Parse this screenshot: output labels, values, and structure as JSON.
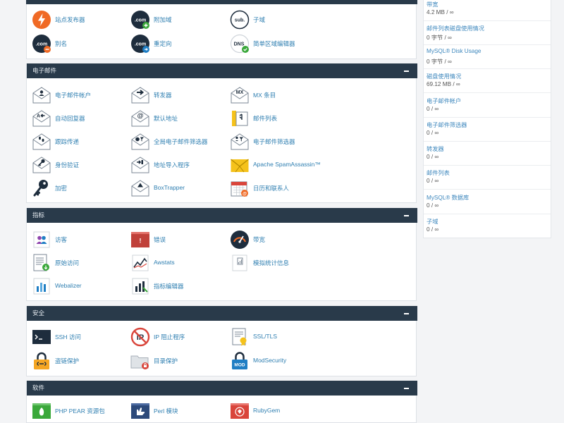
{
  "top_section": {
    "items": [
      {
        "label": "站点发布器",
        "icon": "bolt-icon"
      },
      {
        "label": "附加域",
        "icon": "dotcom-plus-icon"
      },
      {
        "label": "子域",
        "icon": "sub-icon"
      },
      {
        "label": "别名",
        "icon": "dotcom-minus-icon"
      },
      {
        "label": "重定向",
        "icon": "dotcom-redirect-icon"
      },
      {
        "label": "简单区域编辑器",
        "icon": "dns-icon"
      }
    ]
  },
  "email_section": {
    "title": "电子邮件",
    "items": [
      {
        "label": "电子邮件帐户",
        "icon": "email-accounts-icon"
      },
      {
        "label": "转发器",
        "icon": "forwarders-icon"
      },
      {
        "label": "MX 条目",
        "icon": "mx-entry-icon",
        "badge": "MX"
      },
      {
        "label": "自动回复器",
        "icon": "autoresponder-icon"
      },
      {
        "label": "默认地址",
        "icon": "default-address-icon"
      },
      {
        "label": "邮件列表",
        "icon": "mailing-lists-icon"
      },
      {
        "label": "跟踪传递",
        "icon": "track-delivery-icon"
      },
      {
        "label": "全局电子邮件筛选器",
        "icon": "global-filters-icon"
      },
      {
        "label": "电子邮件筛选器",
        "icon": "email-filters-icon"
      },
      {
        "label": "身份验证",
        "icon": "authentication-icon"
      },
      {
        "label": "地址导入程序",
        "icon": "address-importer-icon"
      },
      {
        "label": "Apache SpamAssassin™",
        "icon": "spamassassin-icon"
      },
      {
        "label": "加密",
        "icon": "key-icon"
      },
      {
        "label": "BoxTrapper",
        "icon": "boxtrapper-icon"
      },
      {
        "label": "日历和联系人",
        "icon": "calendar-icon"
      }
    ]
  },
  "metrics_section": {
    "title": "指标",
    "items": [
      {
        "label": "访客",
        "icon": "visitors-icon"
      },
      {
        "label": "错误",
        "icon": "errors-icon"
      },
      {
        "label": "带宽",
        "icon": "bandwidth-icon"
      },
      {
        "label": "原始访问",
        "icon": "raw-access-icon"
      },
      {
        "label": "Awstats",
        "icon": "awstats-icon"
      },
      {
        "label": "模拟统计信息",
        "icon": "analog-stats-icon"
      },
      {
        "label": "Webalizer",
        "icon": "webalizer-icon"
      },
      {
        "label": "指标编辑器",
        "icon": "metrics-editor-icon"
      }
    ]
  },
  "security_section": {
    "title": "安全",
    "items": [
      {
        "label": "SSH 访问",
        "icon": "ssh-terminal-icon"
      },
      {
        "label": "IP 阻止程序",
        "icon": "ip-blocker-icon"
      },
      {
        "label": "SSL/TLS",
        "icon": "ssl-certificate-icon"
      },
      {
        "label": "盗链保护",
        "icon": "hotlink-lock-icon"
      },
      {
        "label": "目录保护",
        "icon": "folder-protect-icon"
      },
      {
        "label": "ModSecurity",
        "icon": "modsecurity-icon",
        "badge": "MOD"
      }
    ]
  },
  "software_section": {
    "title": "软件",
    "items": [
      {
        "label": "PHP PEAR 资源包",
        "icon": "php-pear-icon"
      },
      {
        "label": "Perl 模块",
        "icon": "perl-modules-icon"
      },
      {
        "label": "RubyGem",
        "icon": "rubygem-icon"
      }
    ]
  },
  "icon_text": {
    "dotcom": ".com",
    "sub": "sub.",
    "dns": "DNS",
    "ip": "IP"
  },
  "stats": [
    {
      "label": "带宽",
      "value": "4.2 MB / ∞"
    },
    {
      "label": "邮件列表磁盘使用情况",
      "value": "0 字节 / ∞"
    },
    {
      "label": "MySQL® Disk Usage",
      "value": "0 字节 / ∞"
    },
    {
      "label": "磁盘使用情况",
      "value": "69.12 MB / ∞"
    },
    {
      "label": "电子邮件帐户",
      "value": "0 / ∞"
    },
    {
      "label": "电子邮件筛选器",
      "value": "0 / ∞"
    },
    {
      "label": "转发器",
      "value": "0 / ∞"
    },
    {
      "label": "邮件列表",
      "value": "0 / ∞"
    },
    {
      "label": "MySQL® 数据库",
      "value": "0 / ∞"
    },
    {
      "label": "子域",
      "value": "0 / ∞"
    }
  ],
  "colors": {
    "panel_header": "#293a4a",
    "link": "#2f7fb1",
    "orange": "#f06a25",
    "navy": "#1e2d3d",
    "green": "#3aa83a",
    "yellow": "#f5c21b",
    "red": "#d9453b",
    "blue": "#1f7ec4"
  }
}
